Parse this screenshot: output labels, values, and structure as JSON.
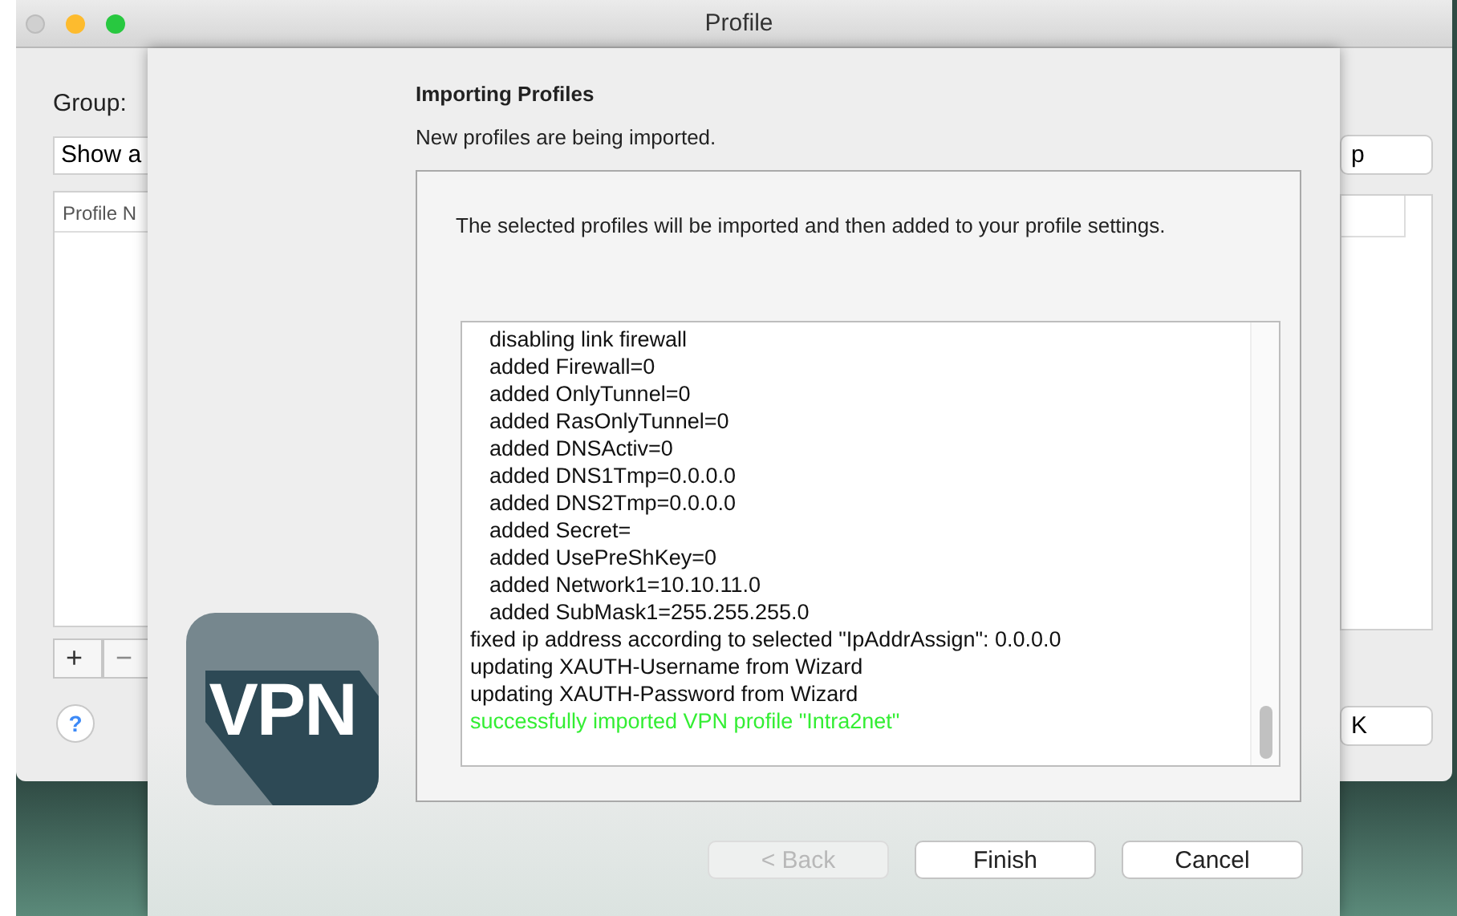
{
  "window": {
    "title": "Profile"
  },
  "background": {
    "group_label": "Group:",
    "group_dropdown": "Show a",
    "table_header": "Profile N",
    "list_buttons": [
      {
        "label": "+",
        "disabled": false
      },
      {
        "label": "−",
        "disabled": true
      }
    ],
    "help_button": "?",
    "right_button": "p",
    "ok_button": "K"
  },
  "sheet": {
    "logo_text": "VPN",
    "title": "Importing Profiles",
    "subtitle": "New profiles are being imported.",
    "description": "The selected profiles will be imported and then added to your profile settings.",
    "log": [
      {
        "kind": "detail",
        "text": "disabling link firewall"
      },
      {
        "kind": "detail",
        "text": "added Firewall=0"
      },
      {
        "kind": "detail",
        "text": "added OnlyTunnel=0"
      },
      {
        "kind": "detail",
        "text": "added RasOnlyTunnel=0"
      },
      {
        "kind": "detail",
        "text": "added DNSActiv=0"
      },
      {
        "kind": "detail",
        "text": "added DNS1Tmp=0.0.0.0"
      },
      {
        "kind": "detail",
        "text": "added DNS2Tmp=0.0.0.0"
      },
      {
        "kind": "detail",
        "text": "added Secret="
      },
      {
        "kind": "detail",
        "text": "added UsePreShKey=0"
      },
      {
        "kind": "detail",
        "text": "added Network1=10.10.11.0"
      },
      {
        "kind": "detail",
        "text": "added SubMask1=255.255.255.0"
      },
      {
        "kind": "info",
        "text": "fixed ip address according to selected \"IpAddrAssign\": 0.0.0.0"
      },
      {
        "kind": "info",
        "text": "updating XAUTH-Username from Wizard"
      },
      {
        "kind": "info",
        "text": "updating XAUTH-Password from Wizard"
      },
      {
        "kind": "success",
        "text": "successfully imported VPN profile \"Intra2net\""
      }
    ],
    "buttons": [
      {
        "label": "< Back",
        "disabled": true
      },
      {
        "label": "Finish",
        "disabled": false
      },
      {
        "label": "Cancel",
        "disabled": false
      }
    ]
  }
}
